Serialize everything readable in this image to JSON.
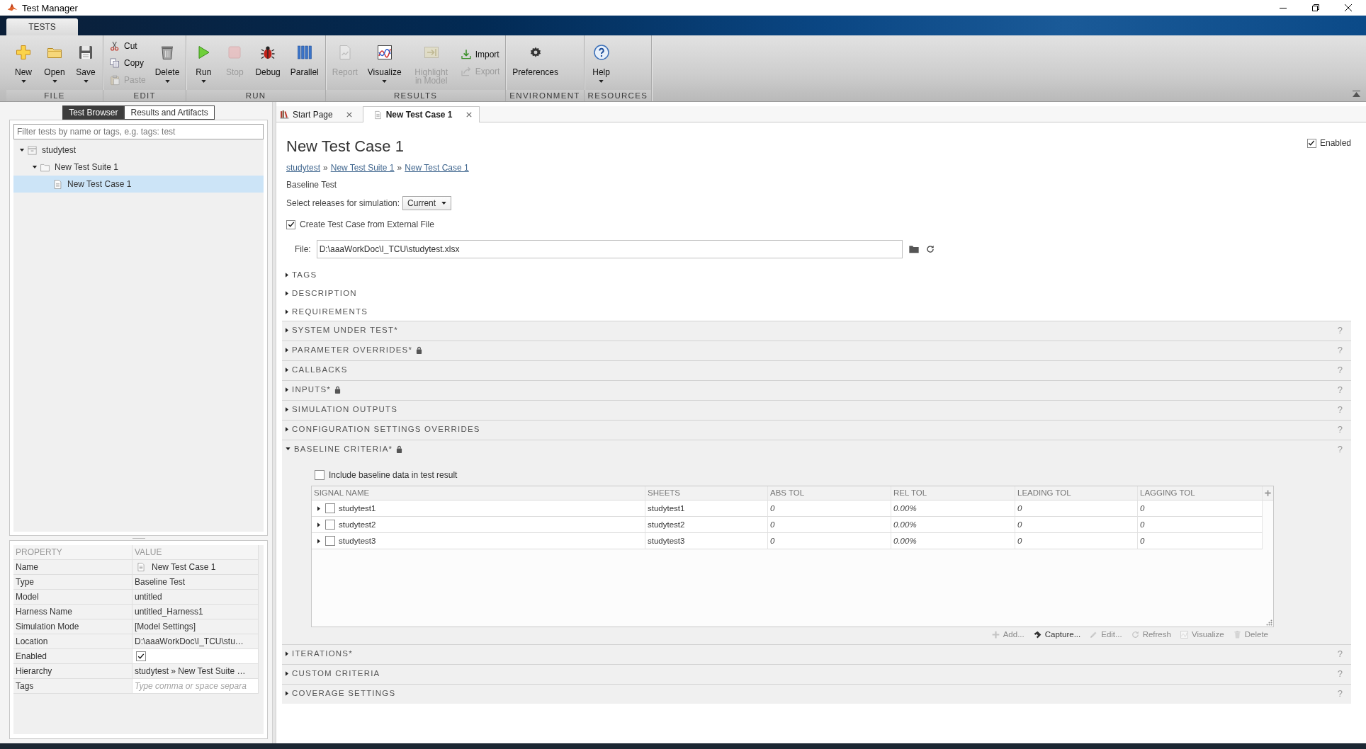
{
  "window": {
    "title": "Test Manager"
  },
  "ribbon": {
    "tabs": [
      {
        "label": "TESTS",
        "selected": true
      }
    ],
    "groups": [
      {
        "label": "FILE",
        "items": [
          {
            "kind": "large",
            "label": "New",
            "menu": true,
            "disabled": false
          },
          {
            "kind": "large",
            "label": "Open",
            "menu": true,
            "disabled": false
          },
          {
            "kind": "large",
            "label": "Save",
            "menu": true,
            "disabled": false
          }
        ]
      },
      {
        "label": "EDIT",
        "items": [
          {
            "kind": "small",
            "label": "Cut",
            "disabled": false
          },
          {
            "kind": "small",
            "label": "Copy",
            "disabled": false
          },
          {
            "kind": "small",
            "label": "Paste",
            "disabled": true
          },
          {
            "kind": "large",
            "label": "Delete",
            "menu": true,
            "disabled": false
          }
        ]
      },
      {
        "label": "RUN",
        "items": [
          {
            "kind": "large",
            "label": "Run",
            "menu": true,
            "disabled": false
          },
          {
            "kind": "large",
            "label": "Stop",
            "menu": false,
            "disabled": true
          },
          {
            "kind": "large",
            "label": "Debug",
            "menu": false,
            "disabled": false
          },
          {
            "kind": "large",
            "label": "Parallel",
            "menu": false,
            "disabled": false
          }
        ]
      },
      {
        "label": "RESULTS",
        "items": [
          {
            "kind": "large",
            "label": "Report",
            "menu": false,
            "disabled": true
          },
          {
            "kind": "large",
            "label": "Visualize",
            "menu": true,
            "disabled": false
          },
          {
            "kind": "large",
            "label": "Highlight in Model",
            "menu": false,
            "disabled": true
          },
          {
            "kind": "small",
            "label": "Import",
            "disabled": false
          },
          {
            "kind": "small",
            "label": "Export",
            "disabled": true
          }
        ]
      },
      {
        "label": "ENVIRONMENT",
        "items": [
          {
            "kind": "large",
            "label": "Preferences",
            "menu": false,
            "disabled": false
          }
        ]
      },
      {
        "label": "RESOURCES",
        "items": [
          {
            "kind": "large",
            "label": "Help",
            "menu": true,
            "disabled": false
          }
        ]
      }
    ]
  },
  "left_panel": {
    "tabs": [
      {
        "label": "Test Browser",
        "selected": true
      },
      {
        "label": "Results and Artifacts",
        "selected": false
      }
    ],
    "filter": {
      "placeholder": "Filter tests by name or tags, e.g. tags: test"
    },
    "tree": [
      {
        "kind": "file",
        "label": "studytest",
        "expanded": true,
        "selected": false,
        "children": [
          {
            "kind": "suite",
            "label": "New Test Suite 1",
            "expanded": true,
            "selected": false,
            "children": [
              {
                "kind": "case",
                "label": "New Test Case 1",
                "selected": true
              }
            ]
          }
        ]
      }
    ]
  },
  "properties": {
    "columns": [
      "PROPERTY",
      "VALUE"
    ],
    "rows": [
      {
        "kind": "document",
        "name": "Name",
        "value": "New Test Case 1"
      },
      {
        "kind": "text",
        "name": "Type",
        "value": "Baseline Test"
      },
      {
        "kind": "text",
        "name": "Model",
        "value": "untitled"
      },
      {
        "kind": "text",
        "name": "Harness Name",
        "value": "untitled_Harness1"
      },
      {
        "kind": "text",
        "name": "Simulation Mode",
        "value": "[Model Settings]"
      },
      {
        "kind": "text",
        "name": "Location",
        "value": "D:\\aaaWorkDoc\\I_TCU\\stu…"
      },
      {
        "kind": "checkbox",
        "name": "Enabled",
        "checked": true
      },
      {
        "kind": "text",
        "name": "Hierarchy",
        "value": "studytest » New Test Suite …"
      },
      {
        "kind": "input",
        "name": "Tags",
        "placeholder": "Type comma or space separa"
      }
    ]
  },
  "editor_tabs": [
    {
      "kind": "start",
      "label": "Start Page",
      "selected": false
    },
    {
      "kind": "test-case",
      "label": "New Test Case 1",
      "selected": true
    }
  ],
  "test_case": {
    "title": "New Test Case 1",
    "enabled": {
      "label": "Enabled",
      "checked": true
    },
    "breadcrumb": [
      {
        "kind": "link",
        "text": "studytest"
      },
      {
        "kind": "separator",
        "text": "»"
      },
      {
        "kind": "link",
        "text": "New Test Suite 1"
      },
      {
        "kind": "separator",
        "text": "»"
      },
      {
        "kind": "link",
        "text": "New Test Case 1"
      }
    ],
    "type": "Baseline Test",
    "releases": {
      "label": "Select releases for simulation:",
      "value": "Current"
    },
    "external_file": {
      "label": "Create Test Case from External File",
      "checked": true
    },
    "file": {
      "label": "File:",
      "value": "D:\\aaaWorkDoc\\I_TCU\\studytest.xlsx"
    },
    "sections": [
      {
        "kind": "plain",
        "title": "TAGS",
        "expanded": false
      },
      {
        "kind": "plain",
        "title": "DESCRIPTION",
        "expanded": false
      },
      {
        "kind": "plain",
        "title": "REQUIREMENTS",
        "expanded": false
      },
      {
        "kind": "panel",
        "title": "SYSTEM UNDER TEST*",
        "expanded": false,
        "locked": false,
        "help": "?"
      },
      {
        "kind": "panel",
        "title": "PARAMETER OVERRIDES*",
        "expanded": false,
        "locked": true,
        "help": "?"
      },
      {
        "kind": "panel",
        "title": "CALLBACKS",
        "expanded": false,
        "locked": false,
        "help": "?"
      },
      {
        "kind": "panel",
        "title": "INPUTS*",
        "expanded": false,
        "locked": true,
        "help": "?"
      },
      {
        "kind": "panel",
        "title": "SIMULATION OUTPUTS",
        "expanded": false,
        "locked": false,
        "help": "?"
      },
      {
        "kind": "panel",
        "title": "CONFIGURATION SETTINGS OVERRIDES",
        "expanded": false,
        "locked": false,
        "help": "?"
      },
      {
        "kind": "panel",
        "title": "BASELINE CRITERIA*",
        "expanded": true,
        "locked": true,
        "help": "?",
        "content": {
          "include": {
            "label": "Include baseline data in test result",
            "checked": false
          },
          "columns": [
            "SIGNAL NAME",
            "SHEETS",
            "ABS TOL",
            "REL TOL",
            "LEADING TOL",
            "LAGGING TOL"
          ],
          "rows": [
            {
              "signal": "studytest1",
              "sheet": "studytest1",
              "abs_tol": "0",
              "rel_tol": "0.00%",
              "leading_tol": "0",
              "lagging_tol": "0",
              "expanded": false,
              "checked": false
            },
            {
              "signal": "studytest2",
              "sheet": "studytest2",
              "abs_tol": "0",
              "rel_tol": "0.00%",
              "leading_tol": "0",
              "lagging_tol": "0",
              "expanded": false,
              "checked": false
            },
            {
              "signal": "studytest3",
              "sheet": "studytest3",
              "abs_tol": "0",
              "rel_tol": "0.00%",
              "leading_tol": "0",
              "lagging_tol": "0",
              "expanded": false,
              "checked": false
            }
          ],
          "actions": [
            {
              "label": "Add...",
              "disabled": true
            },
            {
              "label": "Capture...",
              "disabled": false
            },
            {
              "label": "Edit...",
              "disabled": true
            },
            {
              "label": "Refresh",
              "disabled": true
            },
            {
              "label": "Visualize",
              "disabled": true
            },
            {
              "label": "Delete",
              "disabled": true
            }
          ]
        }
      },
      {
        "kind": "panel",
        "title": "ITERATIONS*",
        "expanded": false,
        "locked": false,
        "help": "?"
      },
      {
        "kind": "panel",
        "title": "CUSTOM CRITERIA",
        "expanded": false,
        "locked": false,
        "help": "?"
      },
      {
        "kind": "panel",
        "title": "COVERAGE SETTINGS",
        "expanded": false,
        "locked": false,
        "help": "?"
      }
    ]
  }
}
